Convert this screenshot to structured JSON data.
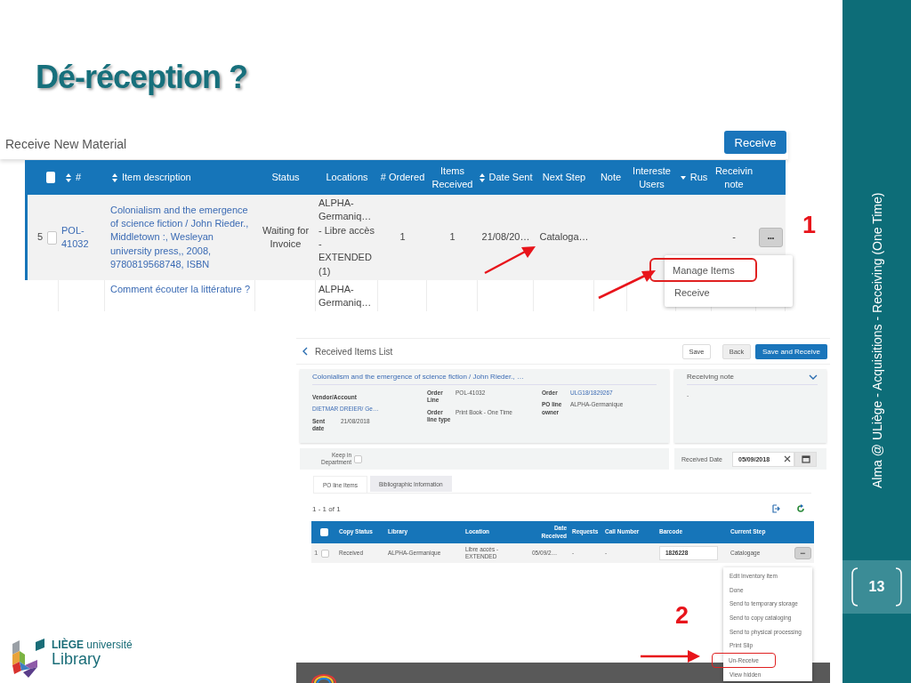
{
  "slide": {
    "title": "Dé-réception ?",
    "sidebar_text": "Alma @ ULiège - Acquisitions - Receiving (One Time)",
    "page_number": "13"
  },
  "logo": {
    "name_line": "**LIÈGE** université",
    "library": "Library"
  },
  "receive_screen": {
    "title": "Receive New Material",
    "action_button": "Receive",
    "select_all_checked": false,
    "columns": [
      {
        "label": "#",
        "sortable": true,
        "sorted": false
      },
      {
        "label": "Item description",
        "sortable": true,
        "sorted": false
      },
      {
        "label": "Status",
        "sortable": false,
        "sorted": false
      },
      {
        "label": "Locations",
        "sortable": false,
        "sorted": false
      },
      {
        "label": "# Ordered",
        "sortable": false,
        "sorted": false
      },
      {
        "label": "Items Received",
        "sortable": false,
        "sorted": false
      },
      {
        "label": "Date Sent",
        "sortable": true,
        "sorted": false
      },
      {
        "label": "Next Step",
        "sortable": false,
        "sorted": false
      },
      {
        "label": "Note",
        "sortable": false,
        "sorted": false
      },
      {
        "label": "Intereste Users",
        "sortable": false,
        "sorted": false
      },
      {
        "label": "Rus",
        "sortable": false,
        "sorted": true
      },
      {
        "label": "Receivin note",
        "sortable": false,
        "sorted": false
      }
    ],
    "rows": [
      {
        "row_number": "5",
        "checked": false,
        "cells": [
          {
            "text": "POL-41032",
            "link": true
          },
          {
            "text": "Colonialism and the emergence of science fiction / John Rieder., Middletown :, Wesleyan university press,, 2008, 9780819568748, ISBN",
            "link": true
          },
          {
            "text": "Waiting for Invoice"
          },
          {
            "text": "ALPHA-Germaniq… - Libre accès - EXTENDED (1)"
          },
          {
            "text": "1"
          },
          {
            "text": "1"
          },
          {
            "text": "21/08/20…"
          },
          {
            "text": "Cataloga…"
          },
          null,
          null,
          null,
          {
            "text": "-"
          }
        ],
        "menu_button": "•••"
      },
      {
        "cells": [
          null,
          {
            "text": "Comment écouter la littérature ?",
            "link": true
          },
          null,
          {
            "text": "ALPHA-Germaniq…"
          },
          null,
          null,
          null,
          null,
          null,
          null,
          null,
          null
        ]
      }
    ],
    "menu": [
      {
        "label": "Manage Items",
        "highlighted": true
      },
      {
        "label": "Receive",
        "highlighted": false
      }
    ],
    "callout": "1"
  },
  "received_screen": {
    "title": "Received Items List",
    "buttons": [
      {
        "label": "Save",
        "kind": "default"
      },
      {
        "label": "Back",
        "kind": "secondary"
      },
      {
        "label": "Save and Receive",
        "kind": "primary"
      }
    ],
    "item_title": "Colonialism and the emergence of science fiction / John Rieder., …",
    "details": [
      [
        {
          "label": "Vendor/Account",
          "value": "DIETMAR DREIER/ Ge…",
          "link": true
        },
        {
          "label": "Sent date",
          "value": "21/08/2018",
          "link": false
        }
      ],
      [
        {
          "label": "Order Line",
          "value": "POL-41032",
          "link": false
        },
        {
          "label": "Order line type",
          "value": "Print Book - One Time",
          "link": false
        }
      ],
      [
        {
          "label": "Order",
          "value": "ULG18/1829267",
          "link": true
        },
        {
          "label": "PO line owner",
          "value": "ALPHA-Germanique",
          "link": false
        }
      ]
    ],
    "receiving_note": {
      "label": "Receiving note",
      "value": "-"
    },
    "keep_in_department": {
      "label": "Keep in Department",
      "checked": false
    },
    "received_date": {
      "label": "Received Date",
      "value": "05/09/2018"
    },
    "tabs": [
      {
        "label": "PO line Items",
        "selected": true
      },
      {
        "label": "Bibliographic Information",
        "selected": false
      }
    ],
    "count": "1 - 1 of 1",
    "select_all_checked": false,
    "columns": [
      "Copy Status",
      "Library",
      "Location",
      "Date Received",
      "Requests",
      "Call Number",
      "Barcode",
      "Current Step"
    ],
    "rows": [
      {
        "row_number": "1",
        "checked": false,
        "copy_status": "Received",
        "library": "ALPHA-Germanique",
        "location": "Libre accès - EXTENDED",
        "date_received": "05/09/2…",
        "requests": "-",
        "call_number": "-",
        "barcode": "1826228",
        "current_step": "Catalogage",
        "menu_button": "•••"
      }
    ],
    "menu": [
      {
        "label": "Edit Inventory item",
        "highlighted": false
      },
      {
        "label": "Done",
        "highlighted": false
      },
      {
        "label": "Send to temporary storage",
        "highlighted": false
      },
      {
        "label": "Send to copy cataloging",
        "highlighted": false
      },
      {
        "label": "Send to physical processing",
        "highlighted": false
      },
      {
        "label": "Print Slip",
        "highlighted": false
      },
      {
        "label": "Un-Receive",
        "highlighted": true
      },
      {
        "label": "View hidden",
        "highlighted": false
      }
    ],
    "callout": "2"
  }
}
